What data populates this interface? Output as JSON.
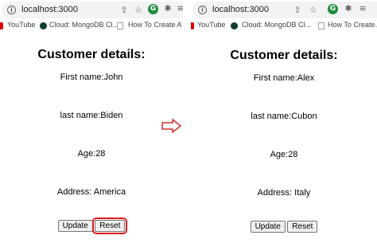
{
  "panes": [
    {
      "url": "localhost:3000",
      "bookmarks": [
        "YouTube",
        "Cloud: MongoDB Cl...",
        "How To Create A Cl..."
      ],
      "heading": "Customer details:",
      "first_name": "First name:John",
      "last_name": "last name:Biden",
      "age": "Age:28",
      "address": "Address: America",
      "update_label": "Update",
      "reset_label": "Reset"
    },
    {
      "url": "localhost:3000",
      "bookmarks": [
        "YouTube",
        "Cloud: MongoDB Cl...",
        "How To Create A Cl..."
      ],
      "heading": "Customer details:",
      "first_name": "First name:Alex",
      "last_name": "last name:Cubon",
      "age": "Age:28",
      "address": "Address: Italy",
      "update_label": "Update",
      "reset_label": "Reset"
    }
  ],
  "icons": {
    "arrow": "right-arrow-outline",
    "toolbar": [
      "share-icon",
      "star-icon",
      "grammarly-icon",
      "extensions-icon",
      "reading-list-icon"
    ]
  },
  "colors": {
    "highlight": "#e01b1b",
    "arrow": "#d32f2f"
  }
}
